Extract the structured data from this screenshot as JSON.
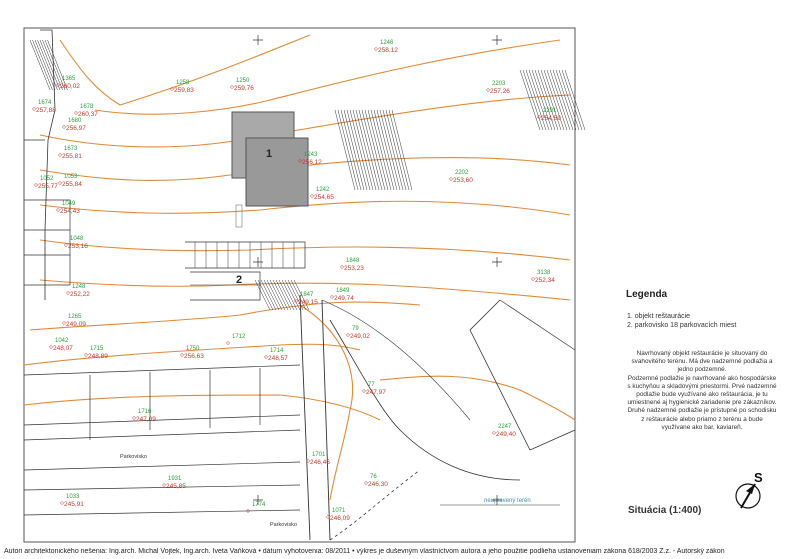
{
  "plan": {
    "buildings": [
      {
        "label": "1"
      },
      {
        "label": "2"
      }
    ],
    "elevations": [
      {
        "num": "1258",
        "val": "259,83"
      },
      {
        "num": "1250",
        "val": "259,76"
      },
      {
        "num": "1246",
        "val": "258,12"
      },
      {
        "num": "1678",
        "val": "260,37"
      },
      {
        "num": "1365",
        "val": "260,02"
      },
      {
        "num": "1674",
        "val": "257,88"
      },
      {
        "num": "1680",
        "val": "256,97"
      },
      {
        "num": "1673",
        "val": "255,81"
      },
      {
        "num": "1052",
        "val": "255,77"
      },
      {
        "num": "1053",
        "val": "255,84"
      },
      {
        "num": "1049",
        "val": "254,43"
      },
      {
        "num": "1048",
        "val": "253,16"
      },
      {
        "num": "1248",
        "val": "252,22"
      },
      {
        "num": "1265",
        "val": "249,09"
      },
      {
        "num": "1243",
        "val": "256,12"
      },
      {
        "num": "1242",
        "val": "254,65"
      },
      {
        "num": "2203",
        "val": "257,26"
      },
      {
        "num": "2201",
        "val": "254,59"
      },
      {
        "num": "2202",
        "val": "253,60"
      },
      {
        "num": "1848",
        "val": "253,23"
      },
      {
        "num": "1847",
        "val": "249,15"
      },
      {
        "num": "1849",
        "val": "249,74"
      },
      {
        "num": "3138",
        "val": "252,34"
      },
      {
        "num": "1042",
        "val": "248,07"
      },
      {
        "num": "1715",
        "val": "248,89"
      },
      {
        "num": "1750",
        "val": "256,63"
      },
      {
        "num": "1714",
        "val": "248,57"
      },
      {
        "num": "1712",
        "val": ""
      },
      {
        "num": "2247",
        "val": "249,40"
      },
      {
        "num": "1701",
        "val": "246,46"
      },
      {
        "num": "1716",
        "val": "247,09"
      },
      {
        "num": "1931",
        "val": "245,85"
      },
      {
        "num": "1033",
        "val": "245,91"
      },
      {
        "num": "1774",
        "val": ""
      },
      {
        "num": "1071",
        "val": "246,09"
      },
      {
        "num": "76",
        "val": "246,30"
      },
      {
        "num": "77",
        "val": "247,97"
      },
      {
        "num": "79",
        "val": "249,02"
      }
    ],
    "streetLabels": [
      "Parkovisko",
      "Parkovisko"
    ],
    "terrainNote": "neupravený terén"
  },
  "legend": {
    "title": "Legenda",
    "items": [
      "1. objekt reštaurácie",
      "2. parkovisko 18 parkovacích miest"
    ],
    "paragraphs": [
      "Navrhovaný objekt reštaurácie je situovaný do svahovitého terénu. Má dve nadzemné podlažia a jedno podzemné.",
      "Podzemné podlažie je navrhované ako hospodárske s kuchyňou a skladovými priestormi. Prvé nadzemné podlažie bude využívané ako reštaurácia, je tu umiestnené aj hygienické zariadenie pre zákazníkov. Druhé nadzemné podlažie je prístupné po schodisku z reštaurácie alebo priamo z terénu a bude využívane ako bar, kaviareň."
    ]
  },
  "sheetTitle": "Situácia (1:400)",
  "northArrow": {
    "letter": "S"
  },
  "footer": "Autori architektonického riešenia: Ing.arch. Michal Vojtek, Ing.arch. Iveta Vaňková • dátum vyhotovenia: 08/2011 • výkres je duševným vlastníctvom autora a jeho použitie podlieha ustanoveniam zákona 618/2003 Z.z. - Autorský zákon",
  "colors": {
    "contour": "#e08a3a",
    "elevationValue": "#c0392b",
    "elevationNum": "#2a9d3a",
    "building": "#a9a9a9",
    "line": "#333333"
  }
}
